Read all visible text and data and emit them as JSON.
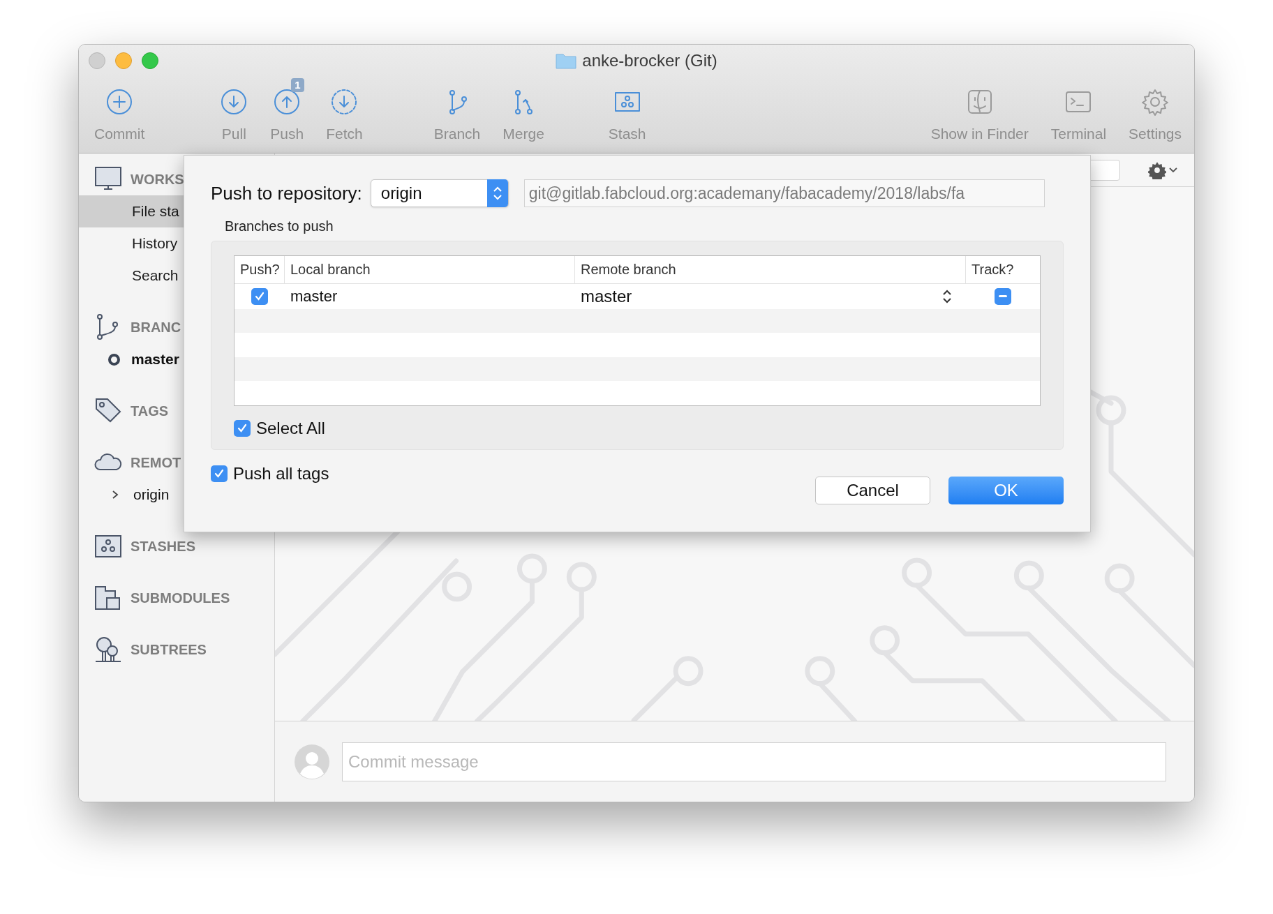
{
  "window": {
    "title": "anke-brocker (Git)",
    "traffic_lights": [
      {
        "kind": "close",
        "active": false
      },
      {
        "kind": "minimize",
        "active": true
      },
      {
        "kind": "zoom",
        "active": true
      }
    ]
  },
  "toolbar": {
    "groups": [
      [
        {
          "label": "Commit"
        }
      ],
      [
        {
          "label": "Pull"
        },
        {
          "label": "Push",
          "badge": "1"
        },
        {
          "label": "Fetch"
        }
      ],
      [
        {
          "label": "Branch"
        },
        {
          "label": "Merge"
        }
      ],
      [
        {
          "label": "Stash"
        }
      ],
      [
        {
          "label": "Show in Finder"
        },
        {
          "label": "Terminal"
        },
        {
          "label": "Settings"
        }
      ]
    ]
  },
  "sidebar": {
    "sections": [
      {
        "title": "WORKS",
        "items": [
          {
            "kind": "view",
            "label": "File sta",
            "selected": true
          },
          {
            "kind": "view",
            "label": "History",
            "selected": false
          },
          {
            "kind": "view",
            "label": "Search",
            "selected": false
          }
        ]
      },
      {
        "title": "BRANC",
        "items": [
          {
            "kind": "branch",
            "label": "master",
            "current": true
          }
        ]
      },
      {
        "title": "TAGS"
      },
      {
        "title": "REMOT",
        "items": [
          {
            "kind": "remote",
            "label": "origin",
            "expanded": false
          }
        ]
      },
      {
        "title": "STASHES"
      },
      {
        "title": "SUBMODULES"
      },
      {
        "title": "SUBTREES"
      }
    ]
  },
  "dialog": {
    "repository_label": "Push to repository:",
    "repository": "origin",
    "url": "git@gitlab.fabcloud.org:academany/fabacademy/2018/labs/fa",
    "branches_label": "Branches to push",
    "table": {
      "columns": [
        "Push?",
        "Local branch",
        "Remote branch",
        "Track?"
      ],
      "rows": [
        {
          "push": true,
          "local": "master",
          "remote": "master",
          "track": true,
          "track_mixed": true
        }
      ]
    },
    "select_all": {
      "label": "Select All",
      "checked": true
    },
    "push_all_tags": {
      "label": "Push all tags",
      "checked": true
    },
    "buttons": [
      {
        "kind": "cancel",
        "label": "Cancel"
      },
      {
        "kind": "default",
        "label": "OK"
      }
    ]
  },
  "commit": {
    "placeholder": "Commit message"
  }
}
